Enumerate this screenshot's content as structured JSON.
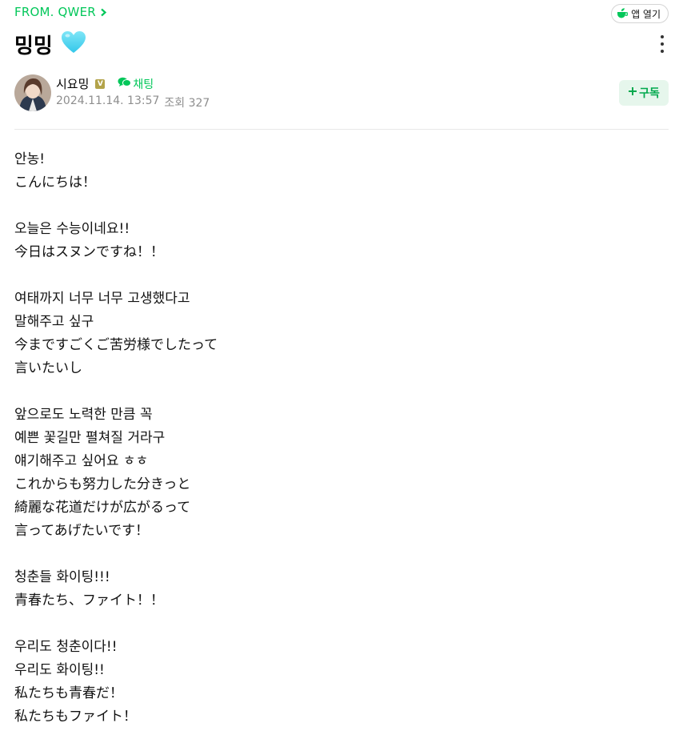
{
  "header": {
    "cafe_link": "FROM. QWER",
    "app_button": "앱 열기"
  },
  "post": {
    "title": "밍밍",
    "author": "시요밍",
    "author_badge": "V",
    "chat_label": "채팅",
    "date": "2024.11.14. 13:57",
    "views": "조회 327",
    "subscribe_label": "구독",
    "lines": [
      "안농!",
      "こんにちは！",
      "",
      "오늘은 수능이네요!!",
      "今日はスヌンですね！！",
      "",
      "여태까지 너무 너무 고생했다고",
      "말해주고 싶구",
      "今まですごくご苦労様でしたって",
      "言いたいし",
      "",
      "앞으로도 노력한 만큼 꼭",
      "예쁜 꽃길만 펼쳐질 거라구",
      "얘기해주고 싶어요 ㅎㅎ",
      "これからも努力した分きっと",
      "綺麗な花道だけが広がるって",
      "言ってあげたいです！",
      "",
      "청춘들 화이팅!!!",
      "青春たち、ファイト！！",
      "",
      "우리도 청춘이다!!",
      "우리도 화이팅!!",
      "私たちも青春だ！",
      "私たちもファイト！"
    ]
  },
  "icons": {
    "title_emoji": "light-blue-heart-icon",
    "chevron": "chevron-right-icon",
    "app": "cafe-app-icon",
    "chat": "chat-bubbles-icon",
    "plus": "plus-icon",
    "more": "kebab-menu-icon"
  },
  "colors": {
    "accent": "#03c75a",
    "meta": "#8e8e8e",
    "subscribe_bg": "#e6f6ec",
    "heart": "#4fd6f0",
    "badge": "#b3a34a"
  }
}
